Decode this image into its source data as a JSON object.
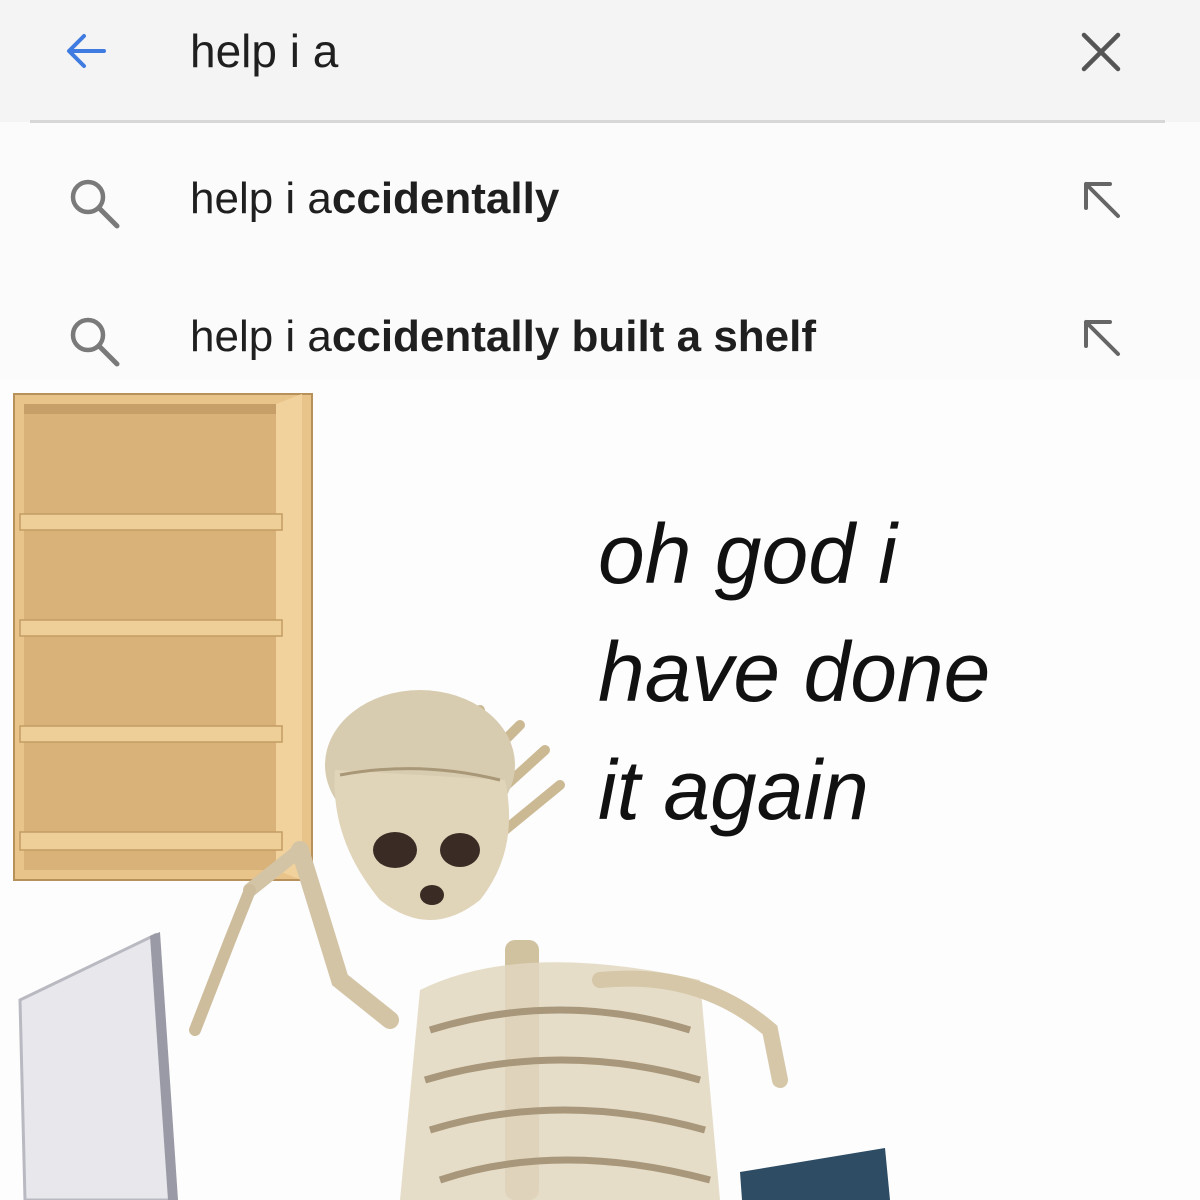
{
  "search": {
    "query": "help i a",
    "back_icon": "arrow-back-icon",
    "clear_icon": "close-icon"
  },
  "suggestions": [
    {
      "prefix": "help i a",
      "completion": "ccidentally",
      "icon": "search-icon",
      "action_icon": "arrow-up-left-icon"
    },
    {
      "prefix": "help i a",
      "completion": "ccidentally built a shelf",
      "icon": "search-icon",
      "action_icon": "arrow-up-left-icon"
    }
  ],
  "meme": {
    "caption": [
      "oh god i",
      "have done",
      "it again"
    ]
  },
  "colors": {
    "accent": "#3f7be0",
    "icon_gray": "#7a7a7a",
    "shelf_wood": "#e8c48c",
    "bone": "#d9ccb0"
  }
}
